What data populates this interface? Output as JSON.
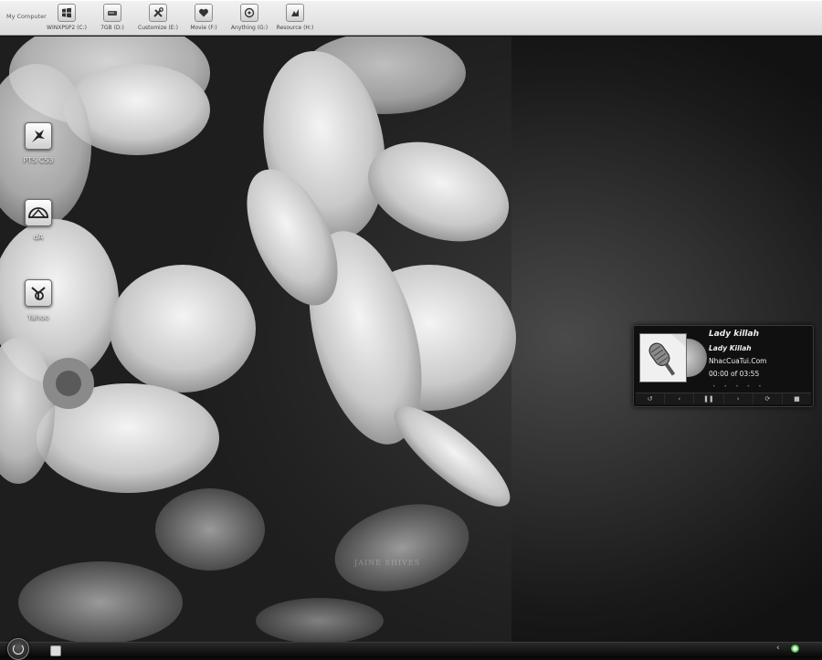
{
  "drivebar": {
    "title": "My Computer",
    "drives": [
      {
        "label": "WINXPSP2 (C:)",
        "icon": "windows-icon"
      },
      {
        "label": "7GB (D:)",
        "icon": "drive-icon"
      },
      {
        "label": "Customize (E:)",
        "icon": "tools-icon"
      },
      {
        "label": "Movie (F:)",
        "icon": "heart-icon"
      },
      {
        "label": "Anything (G:)",
        "icon": "disc-icon"
      },
      {
        "label": "Resource (H:)",
        "icon": "resource-icon"
      }
    ]
  },
  "desktop": {
    "icons": [
      {
        "label": "PTS  CS3",
        "icon": "feather-icon"
      },
      {
        "label": "dA",
        "icon": "deviantart-icon"
      },
      {
        "label": "Yahoo",
        "icon": "yahoo-icon"
      }
    ]
  },
  "player": {
    "title": "Lady killah",
    "artist": "Lady Killah",
    "site": "NhacCuaTui.Com",
    "time": "00:00 of 03:55",
    "controls": [
      "↺",
      "‹",
      "❚❚",
      "›",
      "⟳",
      "■"
    ]
  },
  "watermark": "JAINE SHIVES",
  "colors": {
    "accent": "#3db83d",
    "bar": "#e6e6e6"
  }
}
